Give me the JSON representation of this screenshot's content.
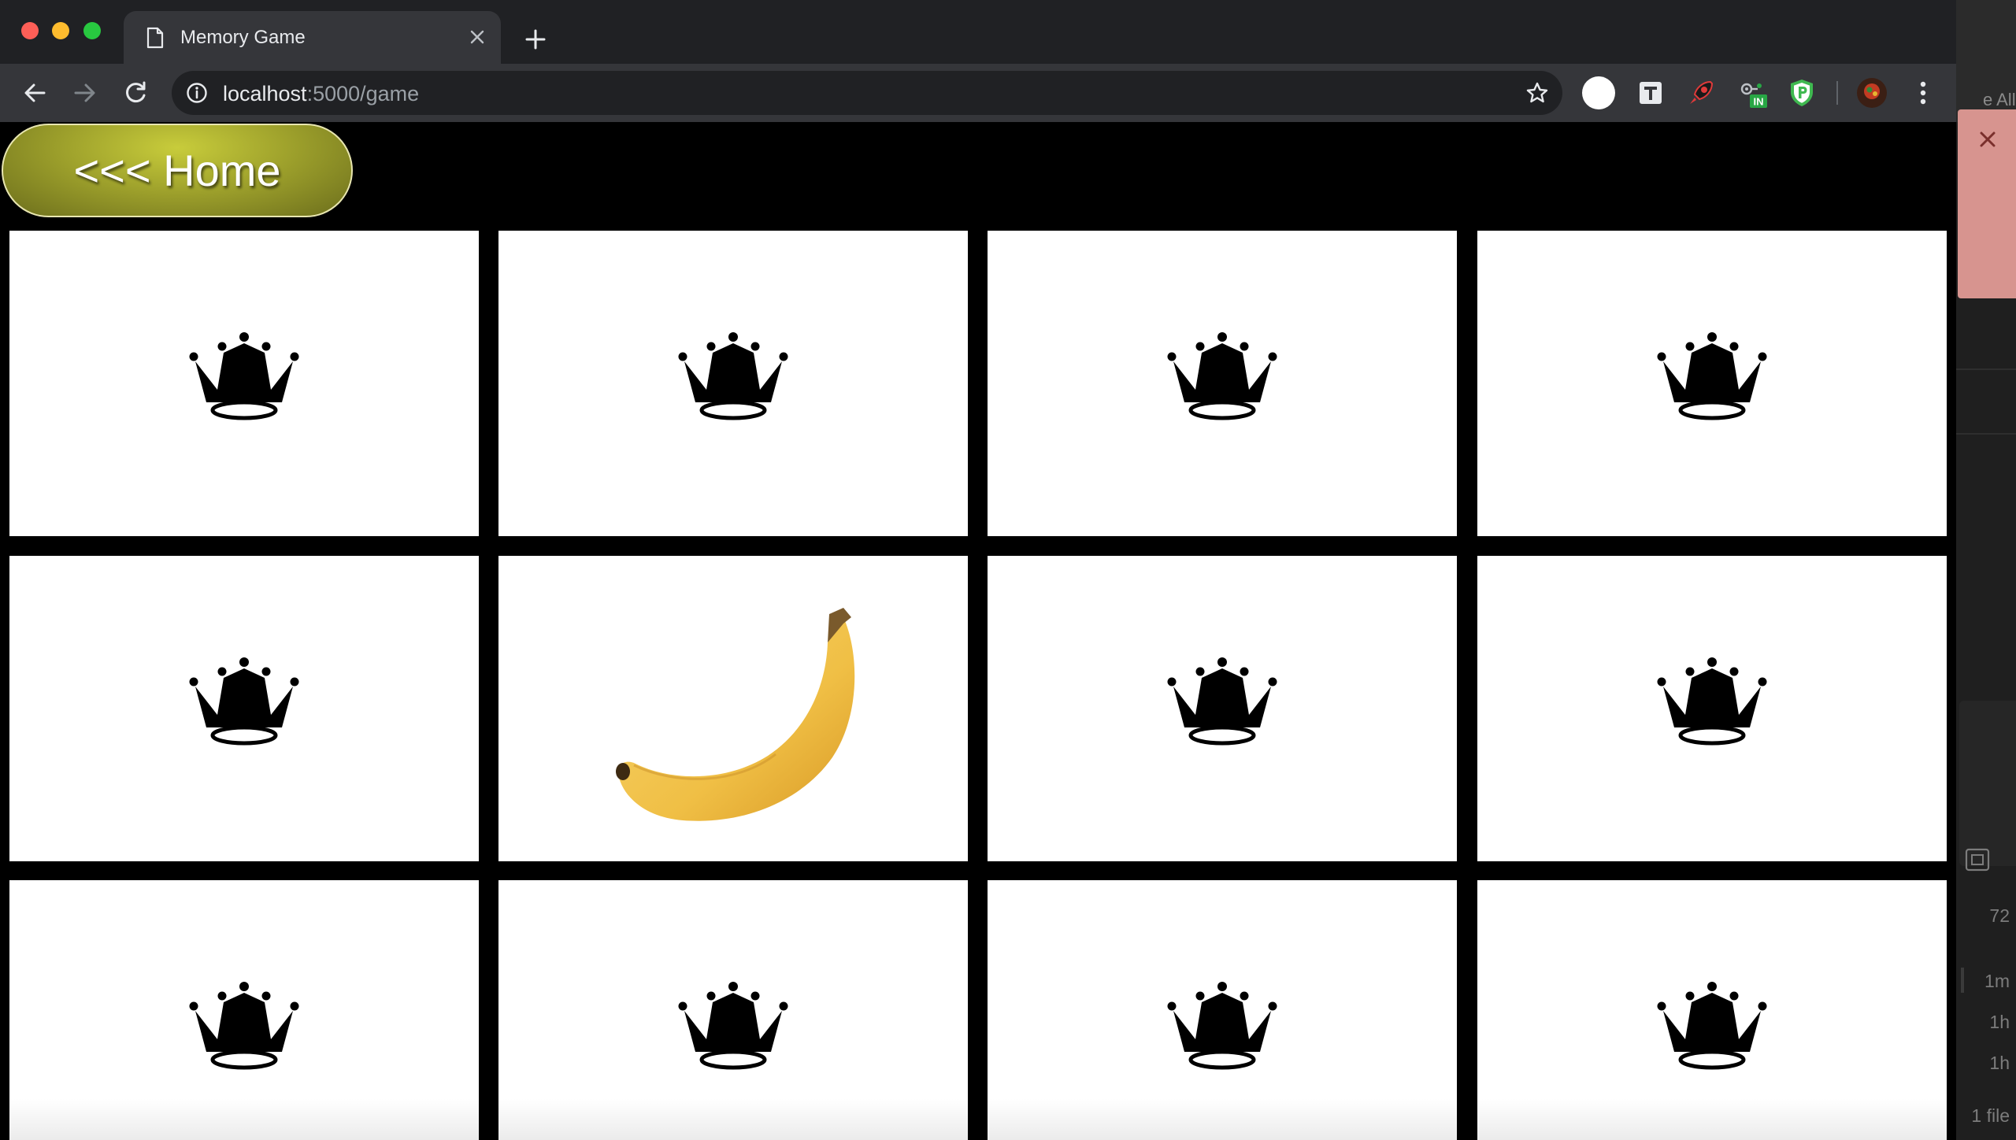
{
  "browser": {
    "tab": {
      "title": "Memory Game",
      "page_icon": "document-icon",
      "close_icon": "close-icon"
    },
    "new_tab_icon": "plus-icon",
    "nav": {
      "back_icon": "back-arrow-icon",
      "forward_icon": "forward-arrow-icon",
      "reload_icon": "reload-icon"
    },
    "address": {
      "host": "localhost",
      "rest": ":5000/game",
      "info_icon": "info-icon",
      "bookmark_icon": "star-icon"
    },
    "extensions": [
      {
        "name": "profile-circle-icon"
      },
      {
        "name": "t-extension-icon",
        "glyph": "T"
      },
      {
        "name": "rocket-extension-icon"
      },
      {
        "name": "linkedin-helper-icon",
        "badge": "IN"
      },
      {
        "name": "shield-p-extension-icon",
        "glyph": "P"
      },
      {
        "name": "user-avatar-icon"
      },
      {
        "name": "menu-kebab-icon"
      }
    ]
  },
  "page": {
    "home_button": {
      "label": "<<< Home"
    },
    "cards": [
      {
        "face": "crown"
      },
      {
        "face": "crown"
      },
      {
        "face": "crown"
      },
      {
        "face": "crown"
      },
      {
        "face": "crown"
      },
      {
        "face": "banana"
      },
      {
        "face": "crown"
      },
      {
        "face": "crown"
      },
      {
        "face": "crown"
      },
      {
        "face": "crown"
      },
      {
        "face": "crown"
      },
      {
        "face": "crown"
      }
    ]
  },
  "background_window": {
    "edge_text": "e All",
    "items": [
      "72",
      "1m",
      "1h",
      "1h",
      "1 file"
    ]
  },
  "colors": {
    "tabbar": "#202124",
    "toolbar": "#35363a",
    "home_button": "#9fa22c",
    "card": "#ffffff",
    "banana": "#f2c24f"
  }
}
